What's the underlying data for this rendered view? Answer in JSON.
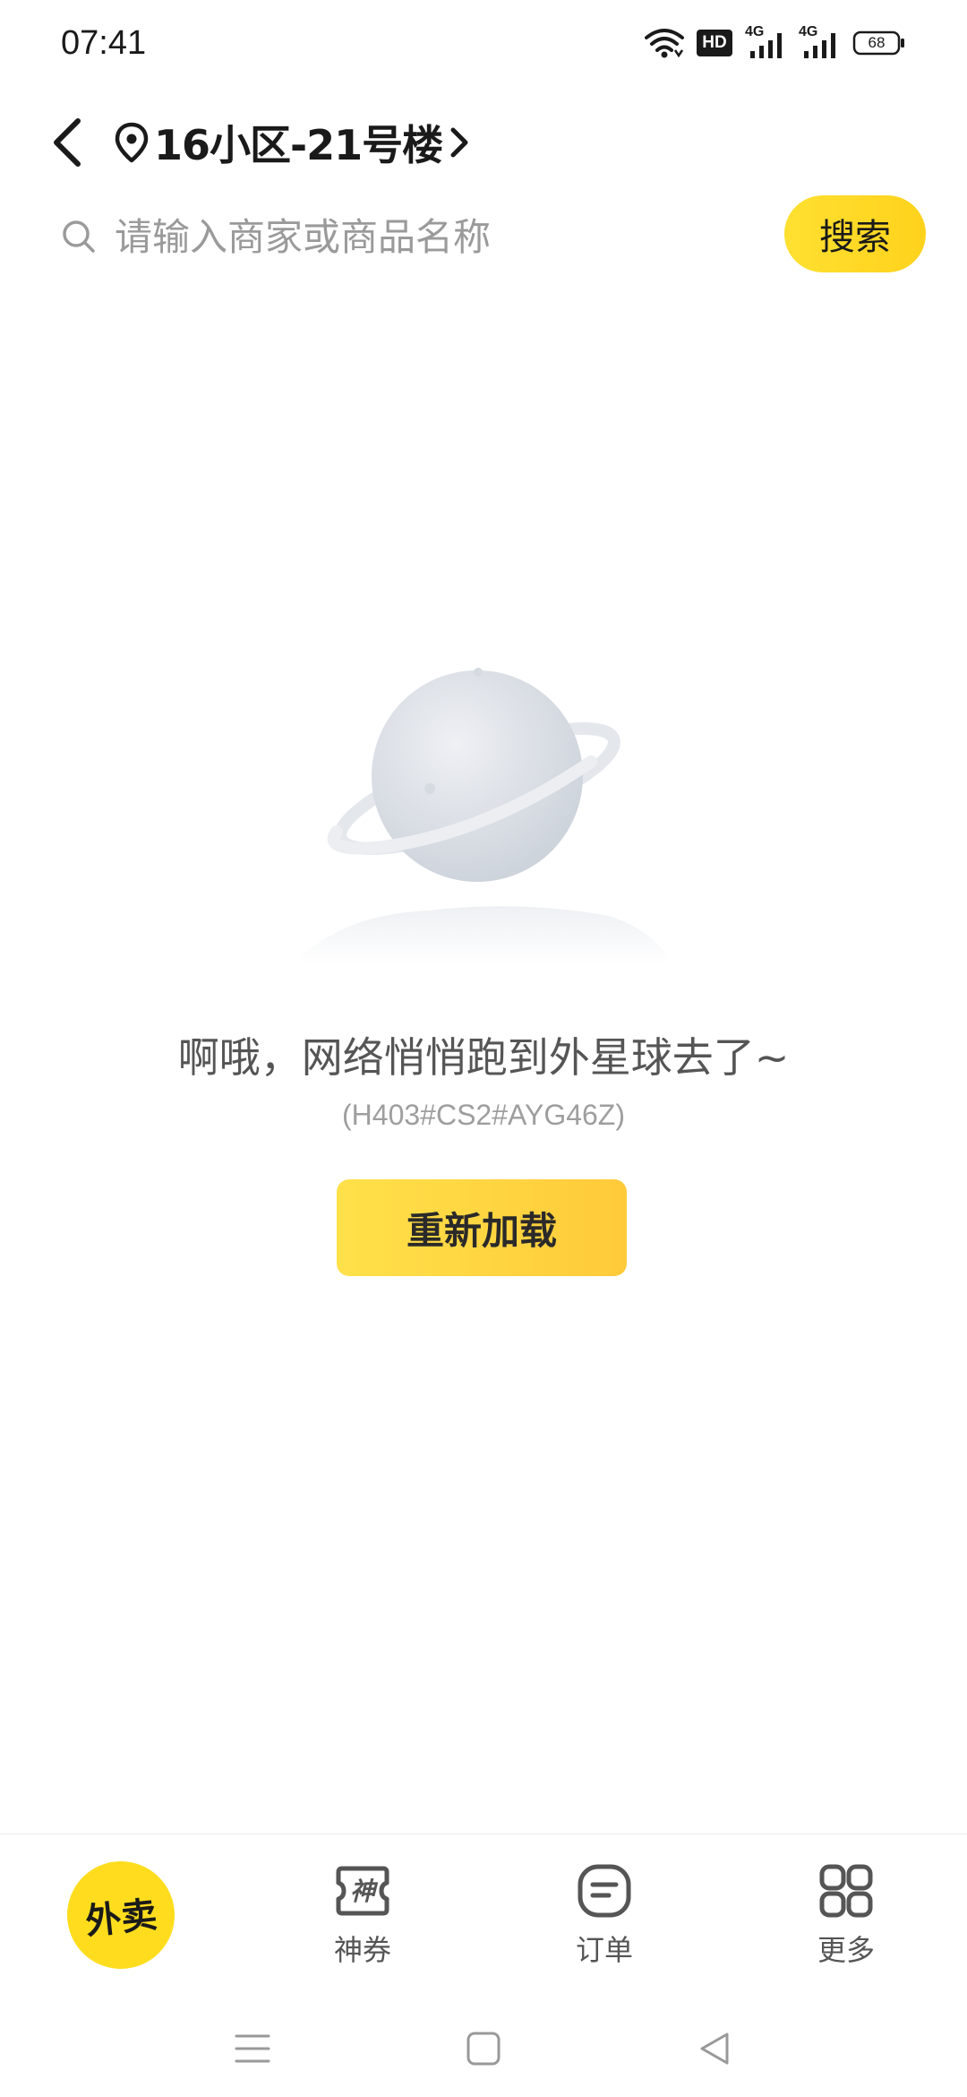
{
  "status_bar": {
    "time": "07:41",
    "hd_label": "HD",
    "network_1": "4G",
    "network_2": "4G",
    "battery_level": "68",
    "icons": [
      "wifi-icon",
      "hd-voice-icon",
      "signal-4g-icon",
      "signal-4g-icon",
      "battery-icon"
    ]
  },
  "header": {
    "back_icon": "chevron-left-icon",
    "location_icon": "location-pin-icon",
    "location_text": "16小区-21号楼",
    "location_chevron": "chevron-right-icon"
  },
  "search": {
    "placeholder": "请输入商家或商品名称",
    "value": "",
    "button_label": "搜索",
    "accent_color": "#FFDD1E"
  },
  "empty_state": {
    "illustration": "planet-icon",
    "message": "啊哦，网络悄悄跑到外星球去了~",
    "error_code": "(H403#CS2#AYG46Z)",
    "reload_label": "重新加载"
  },
  "tab_bar": {
    "items": [
      {
        "label": "外卖",
        "icon": "takeout-home-icon",
        "active": true
      },
      {
        "label": "神券",
        "icon": "coupon-icon",
        "active": false
      },
      {
        "label": "订单",
        "icon": "order-icon",
        "active": false
      },
      {
        "label": "更多",
        "icon": "grid-more-icon",
        "active": false
      }
    ]
  },
  "system_nav": {
    "icons": [
      "menu-icon",
      "home-square-icon",
      "back-triangle-icon"
    ]
  }
}
